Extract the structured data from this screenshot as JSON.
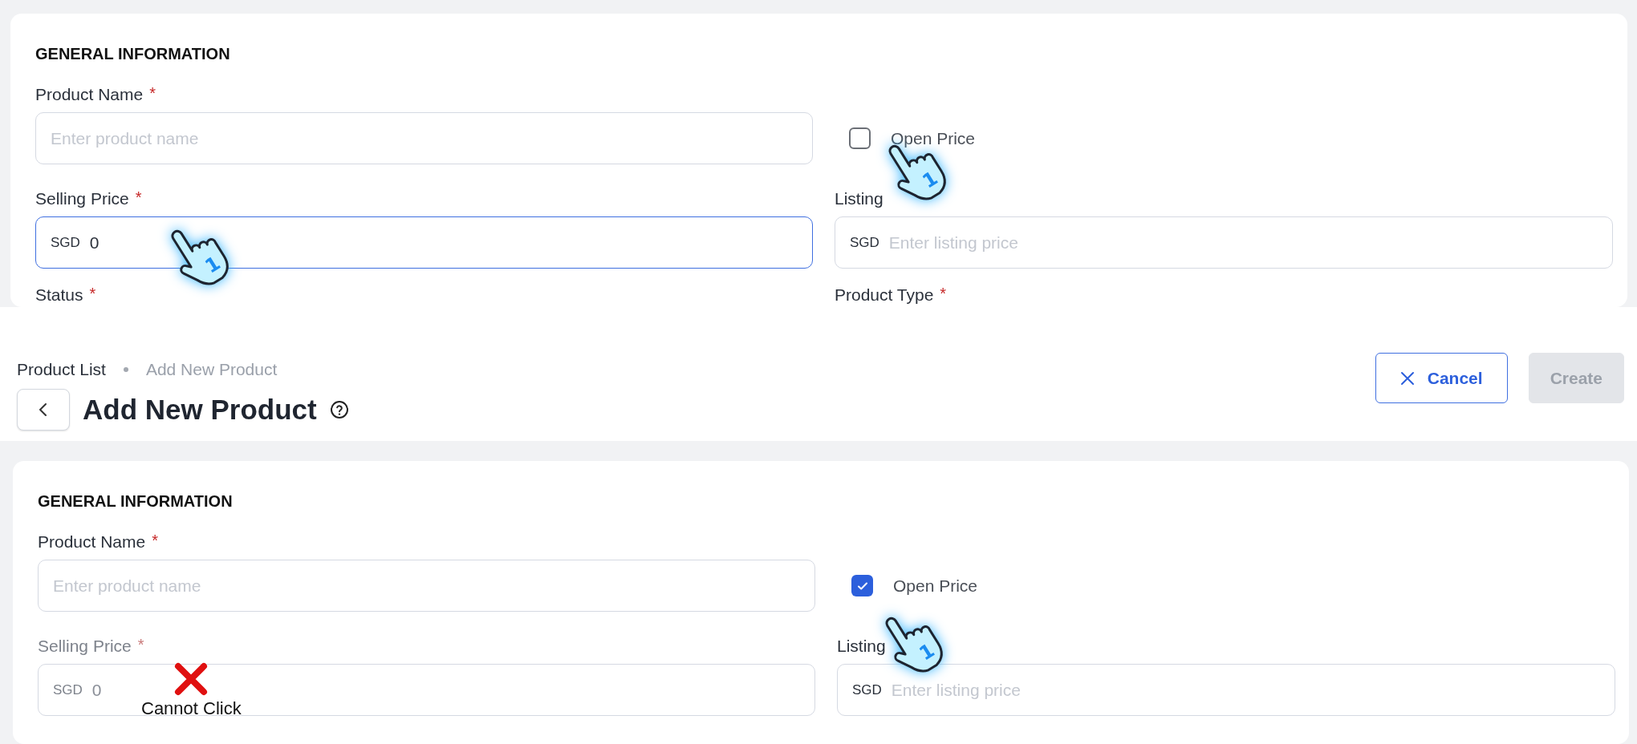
{
  "step_1_panel": {
    "heading": "GENERAL INFORMATION",
    "fields": [
      {
        "kind": "text",
        "label": "Product Name",
        "required_mark": "*",
        "placeholder": "Enter product name"
      },
      {
        "kind": "checkbox",
        "label": "Open Price",
        "checked": false
      },
      {
        "kind": "price",
        "label": "Selling Price",
        "required_mark": "*",
        "prefix": "SGD",
        "value": "0",
        "focused": true,
        "disabled": false
      },
      {
        "kind": "price",
        "label": "Listing",
        "prefix": "SGD",
        "placeholder": "Enter listing price",
        "focused": false,
        "disabled": false
      },
      {
        "kind": "cut_label",
        "label": "Status",
        "required_mark": "*"
      },
      {
        "kind": "cut_label",
        "label": "Product Type",
        "required_mark": "*"
      }
    ],
    "cursors": [
      {
        "badge": "1"
      },
      {
        "badge": "1"
      }
    ]
  },
  "page_header": {
    "breadcrumbs": [
      {
        "label": "Product List",
        "selected": false
      },
      {
        "label": "Add New Product",
        "selected": true
      }
    ],
    "title": "Add New Product",
    "buttons": [
      {
        "kind": "outline",
        "label": "Cancel",
        "disabled": false
      },
      {
        "kind": "primary",
        "label": "Create",
        "disabled": true
      }
    ]
  },
  "step_2_panel": {
    "heading": "GENERAL INFORMATION",
    "fields": [
      {
        "kind": "text",
        "label": "Product Name",
        "required_mark": "*",
        "placeholder": "Enter product name"
      },
      {
        "kind": "checkbox",
        "label": "Open Price",
        "checked": true
      },
      {
        "kind": "price",
        "label": "Selling Price",
        "required_mark": "*",
        "prefix": "SGD",
        "value": "0",
        "focused": false,
        "disabled": true
      },
      {
        "kind": "price",
        "label": "Listing",
        "prefix": "SGD",
        "placeholder": "Enter listing price",
        "focused": false,
        "disabled": false
      }
    ],
    "note": {
      "text": "Cannot Click"
    },
    "cursors": [
      {
        "badge": "1"
      }
    ]
  }
}
